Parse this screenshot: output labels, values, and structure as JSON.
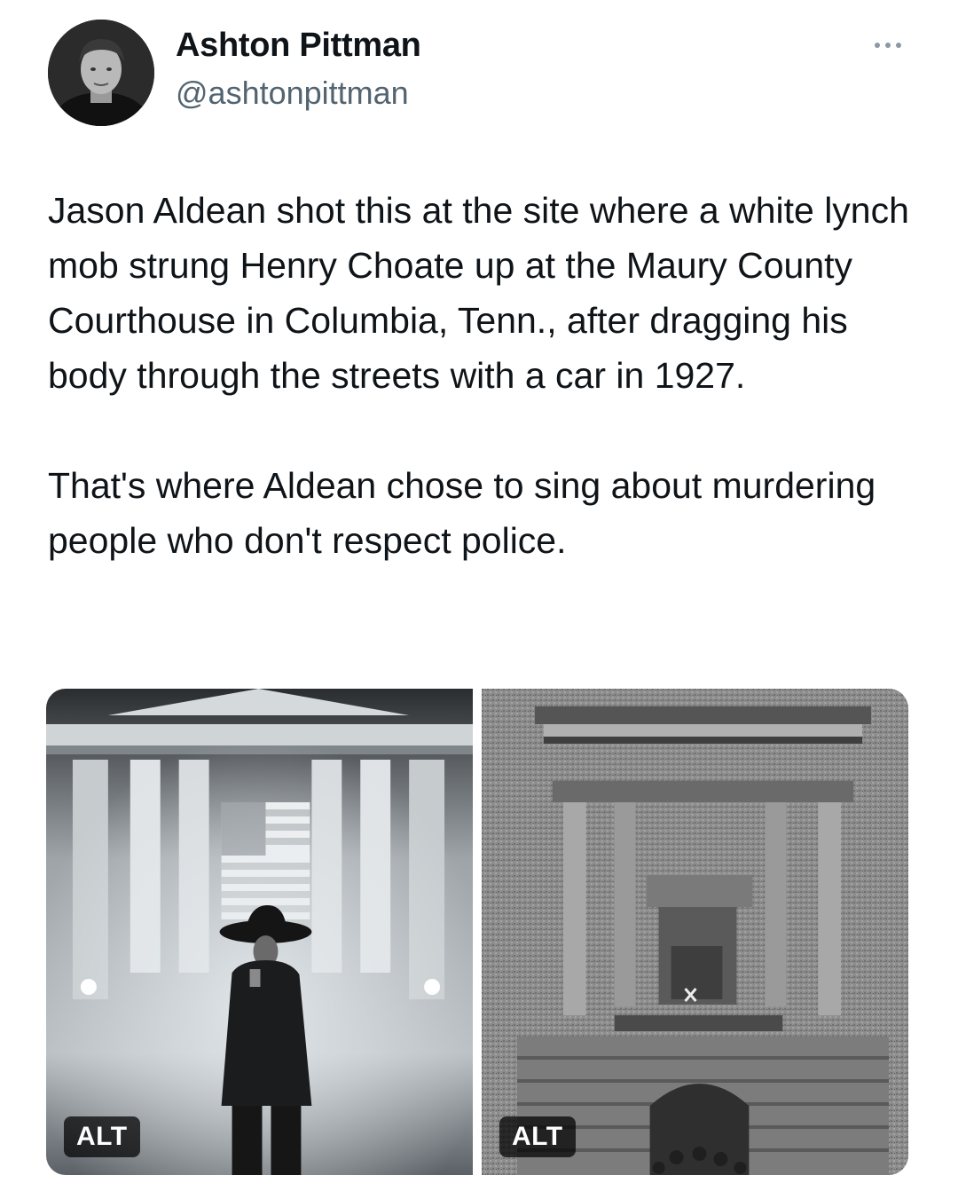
{
  "author": {
    "display_name": "Ashton Pittman",
    "handle": "@ashtonpittman",
    "avatar_icon": "profile-photo"
  },
  "more_icon": "ellipsis-icon",
  "tweet": {
    "paragraphs": [
      "Jason Aldean shot this at the site where a white lynch mob strung Henry Choate up at the Maury County Courthouse in Columbia, Tenn., after dragging his body through the streets with a car in 1927.",
      "That's where Aldean chose to sing about murdering people who don't respect police."
    ]
  },
  "media": {
    "items": [
      {
        "alt_label": "ALT"
      },
      {
        "alt_label": "ALT"
      }
    ]
  },
  "colors": {
    "text_primary": "#0f1419",
    "text_secondary": "#536471",
    "alt_badge_bg": "#000000"
  }
}
